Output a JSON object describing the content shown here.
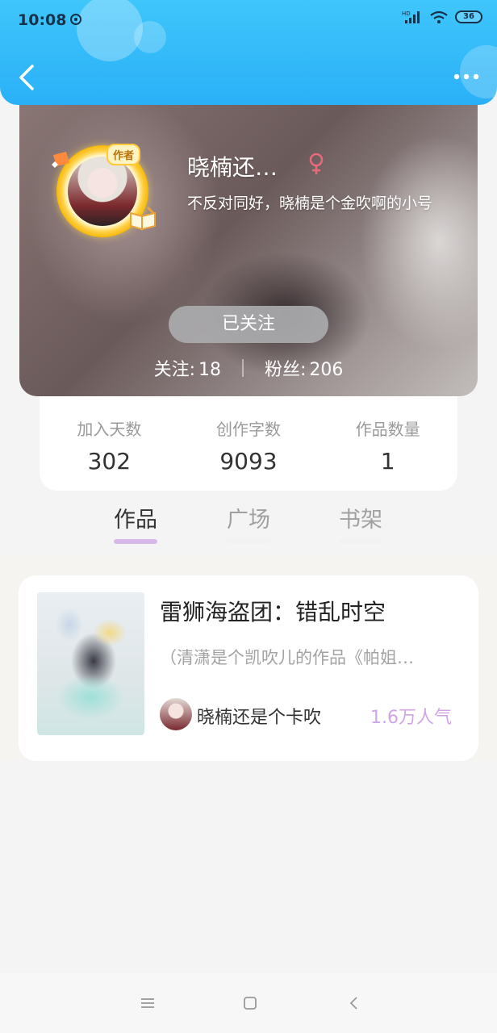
{
  "status_bar": {
    "time": "10:08",
    "battery": "36",
    "network": "HD"
  },
  "profile": {
    "name": "晓楠还…",
    "bio": "不反对同好，晓楠是个金吹啊的小号",
    "author_tag": "作者",
    "follow_button": "已关注",
    "following_label": "关注:",
    "following_count": "18",
    "fans_label": "粉丝:",
    "fans_count": "206"
  },
  "stats": [
    {
      "label": "加入天数",
      "value": "302"
    },
    {
      "label": "创作字数",
      "value": "9093"
    },
    {
      "label": "作品数量",
      "value": "1"
    }
  ],
  "tabs": [
    {
      "label": "作品",
      "active": true
    },
    {
      "label": "广场",
      "active": false
    },
    {
      "label": "书架",
      "active": false
    }
  ],
  "work": {
    "title": "雷狮海盗团：错乱时空",
    "description": "（清潇是个凯吹儿的作品《帕姐…",
    "author": "晓楠还是个卡吹",
    "popularity": "1.6万人气"
  },
  "colors": {
    "header": "#2ab0f7",
    "accent_purple": "#cfa5e6",
    "gender_female": "#e86a7d"
  }
}
